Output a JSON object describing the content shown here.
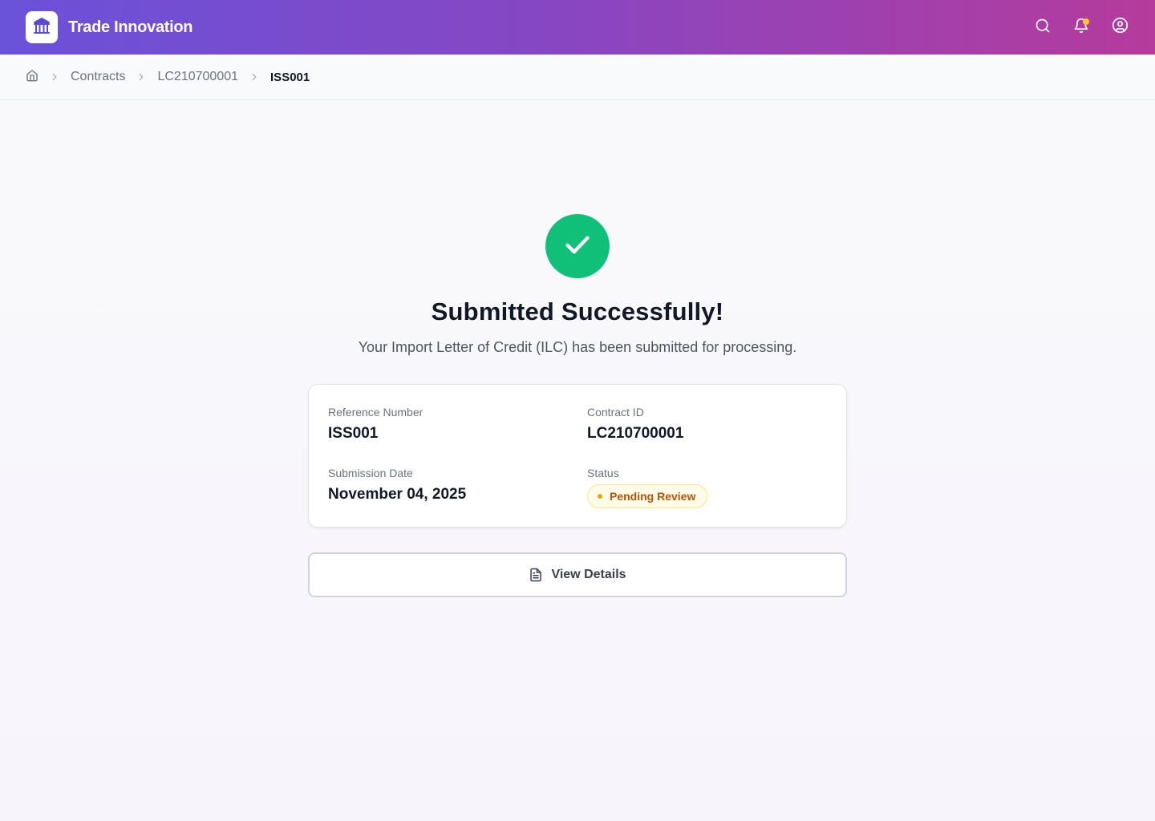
{
  "header": {
    "brand_name": "Trade Innovation",
    "icons": [
      "bank-icon",
      "search-icon",
      "bell-icon",
      "user-circle-icon"
    ],
    "notification_dot_color": "#facc15"
  },
  "breadcrumb": {
    "items": [
      "Contracts",
      "LC210700001"
    ],
    "current": "ISS001"
  },
  "success": {
    "title": "Submitted Successfully!",
    "message": "Your Import Letter of Credit (ILC) has been submitted for processing.",
    "accent_color": "#10bf78"
  },
  "details": {
    "reference_label": "Reference Number",
    "reference_value": "ISS001",
    "contract_label": "Contract ID",
    "contract_value": "LC210700001",
    "date_label": "Submission Date",
    "date_value": "November 04, 2025",
    "status_label": "Status",
    "status_value": "Pending Review"
  },
  "actions": {
    "view_details_label": "View Details"
  }
}
